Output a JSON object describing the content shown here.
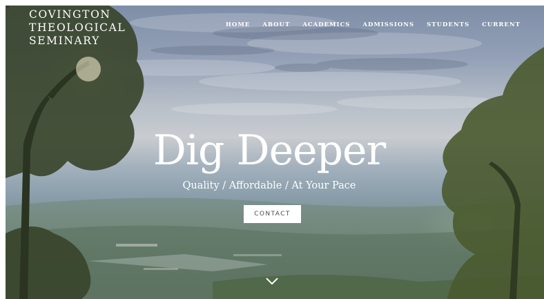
{
  "window": {
    "close_glyph": "×"
  },
  "logo": {
    "lines": [
      "COVINGTON",
      "THEOLOGICAL",
      "SEMINARY"
    ]
  },
  "nav": {
    "items": [
      "HOME",
      "ABOUT",
      "ACADEMICS",
      "ADMISSIONS",
      "STUDENTS",
      "CURRENT"
    ]
  },
  "hero": {
    "headline": "Dig Deeper",
    "tagline": "Quality / Affordable / At Your Pace",
    "contact_label": "CONTACT",
    "scroll_icon": "chevron-down-icon"
  },
  "colors": {
    "text": "#ffffff",
    "button_bg": "#ffffff",
    "button_text": "#4a4a4a",
    "sky_top": "#7f8ea8",
    "foliage": "#51644a"
  }
}
